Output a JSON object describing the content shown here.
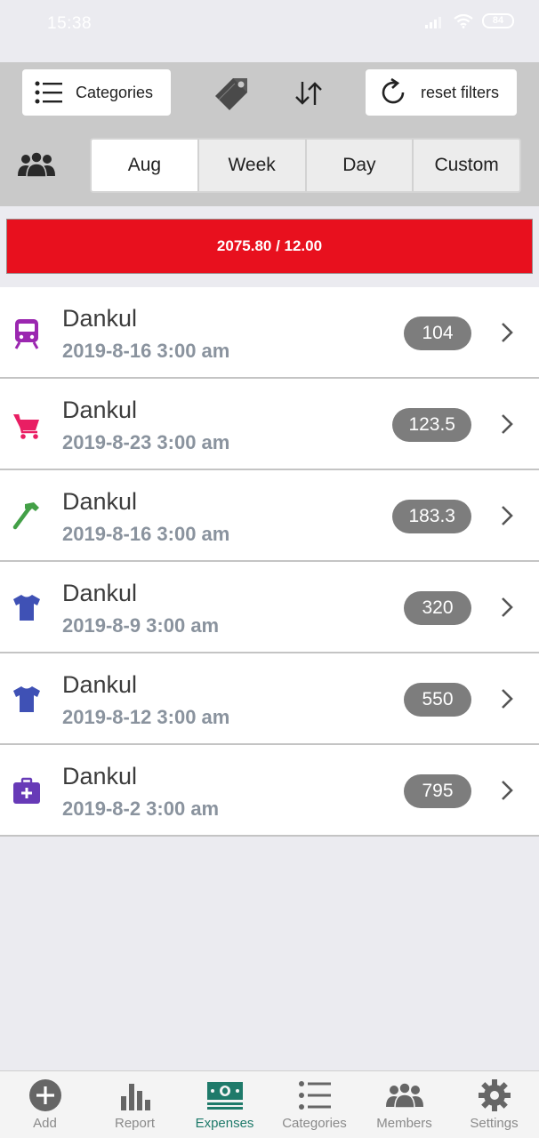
{
  "status": {
    "time": "15:38",
    "battery": "84"
  },
  "toolbar": {
    "categories_label": "Categories",
    "reset_label": "reset filters"
  },
  "periods": [
    "Aug",
    "Week",
    "Day",
    "Custom"
  ],
  "active_period": "Aug",
  "budget": {
    "text": "2075.80 / 12.00",
    "color": "#e8101e"
  },
  "expenses": [
    {
      "title": "Dankul",
      "date": "2019-8-16 3:00 am",
      "amount": "104",
      "icon": "train-icon",
      "color": "#9b27b0"
    },
    {
      "title": "Dankul",
      "date": "2019-8-23 3:00 am",
      "amount": "123.5",
      "icon": "cart-icon",
      "color": "#e91e63"
    },
    {
      "title": "Dankul",
      "date": "2019-8-16 3:00 am",
      "amount": "183.3",
      "icon": "hammer-icon",
      "color": "#43a047"
    },
    {
      "title": "Dankul",
      "date": "2019-8-9 3:00 am",
      "amount": "320",
      "icon": "shirt-icon",
      "color": "#3f51b5"
    },
    {
      "title": "Dankul",
      "date": "2019-8-12 3:00 am",
      "amount": "550",
      "icon": "shirt-icon",
      "color": "#3f51b5"
    },
    {
      "title": "Dankul",
      "date": "2019-8-2 3:00 am",
      "amount": "795",
      "icon": "medkit-icon",
      "color": "#673ab7"
    }
  ],
  "nav": {
    "items": [
      {
        "label": "Add"
      },
      {
        "label": "Report"
      },
      {
        "label": "Expenses"
      },
      {
        "label": "Categories"
      },
      {
        "label": "Members"
      },
      {
        "label": "Settings"
      }
    ],
    "active": "Expenses",
    "active_color": "#1f7a6a"
  }
}
